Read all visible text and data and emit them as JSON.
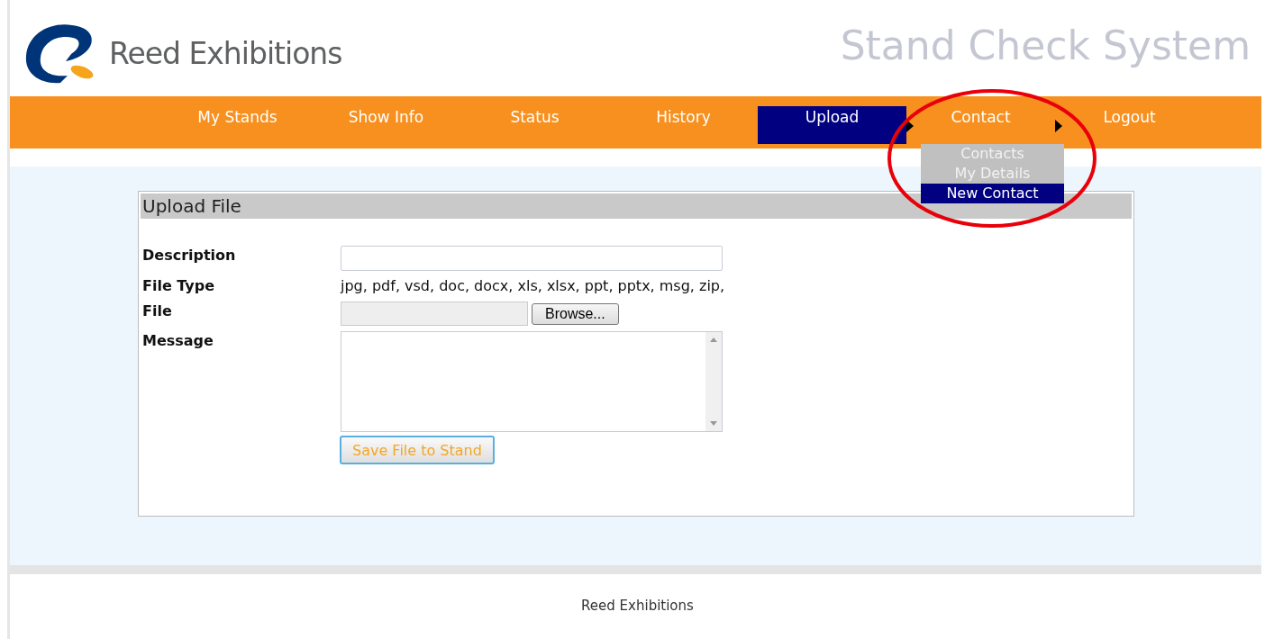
{
  "header": {
    "logo_text": "Reed Exhibitions",
    "site_title": "Stand Check System"
  },
  "nav": [
    {
      "label": "My Stands",
      "selected": false,
      "submenu": false
    },
    {
      "label": "Show Info",
      "selected": false,
      "submenu": false
    },
    {
      "label": "Status",
      "selected": false,
      "submenu": false
    },
    {
      "label": "History",
      "selected": false,
      "submenu": false
    },
    {
      "label": "Upload",
      "selected": true,
      "submenu": true
    },
    {
      "label": "Contact",
      "selected": false,
      "submenu": true,
      "expanded": true,
      "children": [
        {
          "label": "Contacts",
          "selected": false
        },
        {
          "label": "My Details",
          "selected": false
        },
        {
          "label": "New Contact",
          "selected": true
        }
      ]
    },
    {
      "label": "Logout",
      "selected": false,
      "submenu": false
    }
  ],
  "annotation": {
    "kind": "ellipse",
    "color": "#e8000b"
  },
  "panel": {
    "title": "Upload File",
    "fields": [
      {
        "kind": "text",
        "label": "Description"
      },
      {
        "kind": "info",
        "label": "File Type",
        "value": "jpg, pdf, vsd, doc, docx, xls, xlsx, ppt, pptx, msg, zip,"
      },
      {
        "kind": "file",
        "label": "File",
        "button": "Browse..."
      },
      {
        "kind": "textarea",
        "label": "Message"
      }
    ],
    "submit": "Save File to Stand"
  },
  "footer": {
    "text": "Reed Exhibitions"
  }
}
